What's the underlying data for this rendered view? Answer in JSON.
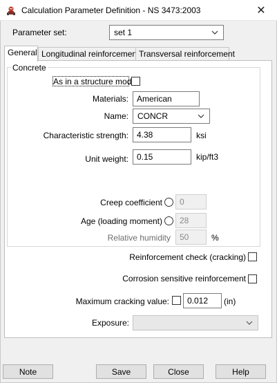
{
  "window": {
    "title": "Calculation Parameter Definition - NS 3473:2003",
    "close_label": "✕"
  },
  "parameter_set": {
    "label": "Parameter set:",
    "value": "set 1"
  },
  "tabs": [
    {
      "label": "General"
    },
    {
      "label": "Longitudinal reinforcement"
    },
    {
      "label": "Transversal reinforcement"
    }
  ],
  "concrete": {
    "legend": "Concrete",
    "as_in_model_label": "As in a structure model",
    "materials_label": "Materials:",
    "materials_value": "American",
    "name_label": "Name:",
    "name_value": "CONCR",
    "char_strength_label": "Characteristic strength:",
    "char_strength_value": "4.38",
    "char_strength_unit": "ksi",
    "unit_weight_label": "Unit weight:",
    "unit_weight_value": "0.15",
    "unit_weight_unit": "kip/ft3",
    "creep_label": "Creep coefficient",
    "creep_value": "0",
    "age_label": "Age (loading moment)",
    "age_value": "28",
    "humidity_label": "Relative humidity",
    "humidity_value": "50",
    "humidity_unit": "%"
  },
  "reinforcement_check_label": "Reinforcement check (cracking)",
  "corrosion_label": "Corrosion sensitive reinforcement",
  "max_cracking": {
    "label": "Maximum cracking value:",
    "value": "0.012",
    "unit": "(in)"
  },
  "exposure": {
    "label": "Exposure:",
    "value": ""
  },
  "buttons": {
    "note": "Note",
    "save": "Save",
    "close": "Close",
    "help": "Help"
  }
}
